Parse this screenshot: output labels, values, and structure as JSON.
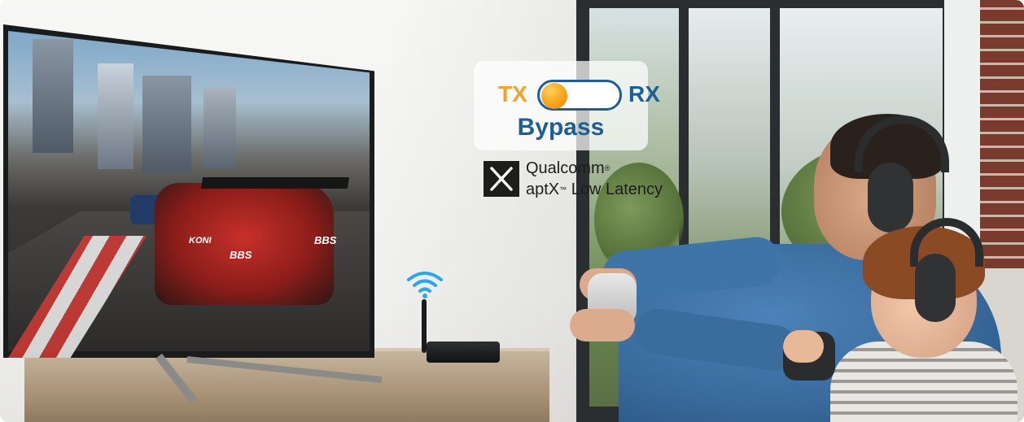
{
  "overlay": {
    "tx_label": "TX",
    "rx_label": "RX",
    "switch_state": "TX",
    "mode_label": "Bypass",
    "colors": {
      "tx": "#f0a32a",
      "rx": "#1f5e95",
      "knob": "#f8a21c"
    }
  },
  "branding": {
    "logo_icon": "aptx-x-logo-icon",
    "line1": "Qualcomm",
    "line1_mark": "®",
    "line2": "aptX",
    "line2_mark": "™",
    "line2_suffix": " Low Latency"
  },
  "tv_game": {
    "car_text_1": "BBS",
    "car_text_2": "BBS",
    "car_text_3": "KONI"
  },
  "icons": {
    "wifi": "wifi-signal-icon"
  }
}
